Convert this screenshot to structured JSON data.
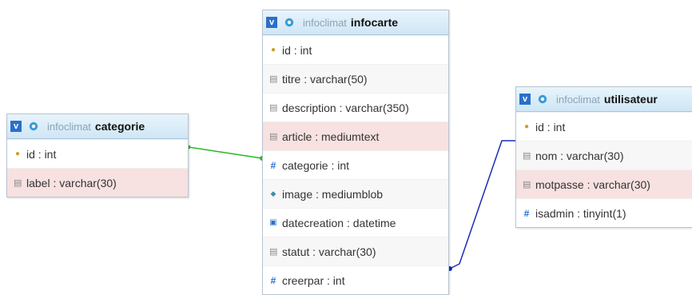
{
  "tables": {
    "categorie": {
      "db": "infoclimat",
      "name": "categorie",
      "fields": [
        {
          "icon": "key-icon",
          "text": "id : int"
        },
        {
          "icon": "text-field-icon",
          "text": "label : varchar(30)"
        }
      ]
    },
    "infocarte": {
      "db": "infoclimat",
      "name": "infocarte",
      "fields": [
        {
          "icon": "key-icon",
          "text": "id : int"
        },
        {
          "icon": "text-field-icon",
          "text": "titre : varchar(50)"
        },
        {
          "icon": "text-field-icon",
          "text": "description : varchar(350)"
        },
        {
          "icon": "text-field-icon",
          "text": "article : mediumtext"
        },
        {
          "icon": "number-field-icon",
          "text": "categorie : int"
        },
        {
          "icon": "blob-field-icon",
          "text": "image : mediumblob"
        },
        {
          "icon": "date-field-icon",
          "text": "datecreation : datetime"
        },
        {
          "icon": "text-field-icon",
          "text": "statut : varchar(30)"
        },
        {
          "icon": "number-field-icon",
          "text": "creerpar : int"
        }
      ]
    },
    "utilisateur": {
      "db": "infoclimat",
      "name": "utilisateur",
      "fields": [
        {
          "icon": "key-icon",
          "text": "id : int"
        },
        {
          "icon": "text-field-icon",
          "text": "nom : varchar(30)"
        },
        {
          "icon": "text-field-icon",
          "text": "motpasse : varchar(30)"
        },
        {
          "icon": "number-field-icon",
          "text": "isadmin : tinyint(1)"
        }
      ]
    }
  },
  "toggle_label": "v",
  "colors": {
    "header_bg": "#cfe6f5",
    "toggle_bg": "#2a6fc9",
    "highlight_row": "#f7e1e1",
    "link_categorie": "#22bb22",
    "link_utilisateur": "#1a2bb8"
  }
}
